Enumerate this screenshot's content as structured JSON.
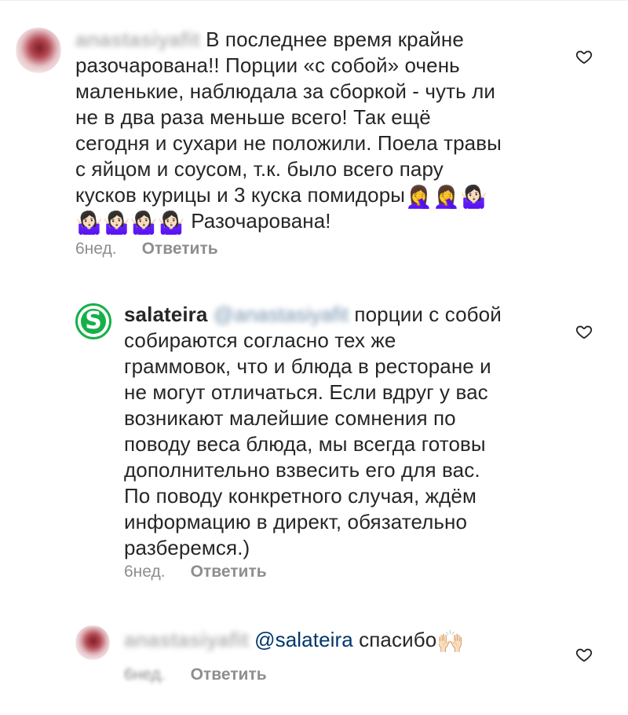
{
  "comments": [
    {
      "username": "anastasiyafit",
      "text_lines": [
        "В последнее время крайне",
        "разочарована!! Порции «с собой» очень",
        "маленькие, наблюдала за сборкой - чуть ли",
        "не в два раза меньше всего! Так ещё",
        "сегодня и сухари не положили. Поела травы",
        "с яйцом и соусом, т.к. было всего пару",
        "кусков курицы и 3 куска помидоры"
      ],
      "emoji_line1": "🤦‍♀️🤦‍♀️🤷🏻‍♀️",
      "emoji_line2": "🤷🏻‍♀️🤷🏻‍♀️🤷🏻‍♀️🤷🏻‍♀️",
      "text_tail": "Разочарована!",
      "time": "6нед.",
      "reply_label": "Ответить",
      "like_icon": "heart-outline-icon"
    },
    {
      "username": "salateira",
      "mention_blurred": "@anastasiyafit",
      "text_first": "порции с собой",
      "text_lines": [
        "собираются согласно тех же",
        "граммовок, что и блюда в ресторане и",
        "не могут отличаться. Если вдруг у вас",
        "возникают малейшие сомнения по",
        "поводу веса блюда, мы всегда готовы",
        "дополнительно взвесить его для вас.",
        "По поводу конкретного случая, ждём",
        "информацию в директ, обязательно",
        "разберемся.)"
      ],
      "avatar_letter": "S",
      "time": "6нед.",
      "reply_label": "Ответить",
      "like_icon": "heart-outline-icon"
    },
    {
      "username": "anastasiyafit",
      "mention": "@salateira",
      "text": "спасибо",
      "emoji": "🙌🏻",
      "time": "6нед.",
      "reply_label": "Ответить",
      "like_icon": "heart-outline-icon"
    }
  ],
  "colors": {
    "text": "#262626",
    "secondary": "#8e8e8e",
    "mention": "#00376b",
    "brand_green": "#16b04a"
  }
}
